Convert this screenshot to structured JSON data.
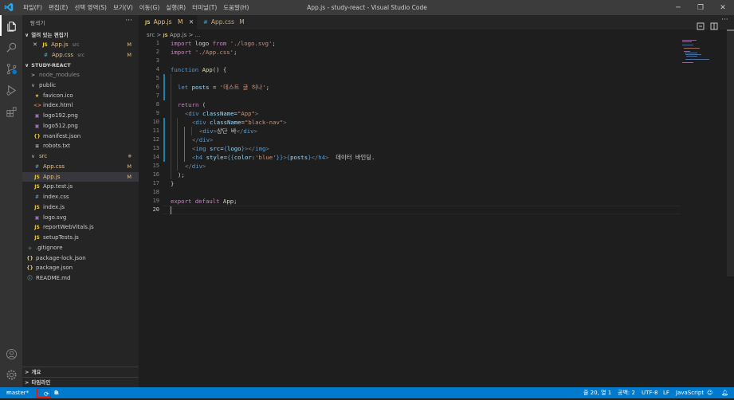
{
  "titlebar": {
    "menus": [
      "파일(F)",
      "편집(E)",
      "선택 영역(S)",
      "보기(V)",
      "이동(G)",
      "실행(R)",
      "터미널(T)",
      "도움말(H)"
    ],
    "window_title": "App.js - study-react - Visual Studio Code",
    "minimize": "─",
    "restore": "❐",
    "close": "✕"
  },
  "sidebar": {
    "header": "탐색기",
    "more": "···",
    "open_editors_title": "열려 있는 편집기",
    "open_editors": [
      {
        "close": "✕",
        "icon": "JS",
        "name": "App.js",
        "folder": "src",
        "badge": "M"
      },
      {
        "icon": "#",
        "name": "App.css",
        "folder": "src",
        "badge": "M"
      }
    ],
    "project_title": "STUDY-REACT",
    "tree": [
      {
        "arrow": ">",
        "name": "node_modules"
      },
      {
        "arrow": "∨",
        "name": "public"
      },
      {
        "icon": "★",
        "name": "favicon.ico"
      },
      {
        "icon": "<>",
        "name": "index.html"
      },
      {
        "icon": "▣",
        "name": "logo192.png"
      },
      {
        "icon": "▣",
        "name": "logo512.png"
      },
      {
        "icon": "{}",
        "name": "manifest.json"
      },
      {
        "icon": "≡",
        "name": "robots.txt"
      },
      {
        "arrow": "∨",
        "name": "src",
        "dot": "●"
      },
      {
        "icon": "#",
        "name": "App.css",
        "badge": "M"
      },
      {
        "icon": "JS",
        "name": "App.js",
        "badge": "M"
      },
      {
        "icon": "JS",
        "name": "App.test.js"
      },
      {
        "icon": "#",
        "name": "index.css"
      },
      {
        "icon": "JS",
        "name": "index.js"
      },
      {
        "icon": "▣",
        "name": "logo.svg"
      },
      {
        "icon": "JS",
        "name": "reportWebVitals.js"
      },
      {
        "icon": "JS",
        "name": "setupTests.js"
      },
      {
        "icon": "◆",
        "name": ".gitignore"
      },
      {
        "icon": "{}",
        "name": "package-lock.json"
      },
      {
        "icon": "{}",
        "name": "package.json"
      },
      {
        "icon": "ⓘ",
        "name": "README.md"
      }
    ],
    "outline_title": "개요",
    "timeline_title": "타임라인"
  },
  "editor": {
    "tabs": [
      {
        "icon": "JS",
        "name": "App.js",
        "badge": "M",
        "close": "✕"
      },
      {
        "icon": "#",
        "name": "App.css",
        "badge": "M"
      }
    ],
    "breadcrumb": [
      "src",
      ">",
      "JS",
      "App.js",
      ">",
      "..."
    ],
    "line_numbers": [
      "1",
      "2",
      "3",
      "4",
      "5",
      "6",
      "7",
      "8",
      "9",
      "10",
      "11",
      "12",
      "13",
      "14",
      "15",
      "16",
      "17",
      "18",
      "19",
      "20"
    ],
    "code": {
      "l1": [
        "import",
        " logo ",
        "from",
        " './logo.svg'",
        ";"
      ],
      "l2": [
        "import",
        " './App.css'",
        ";"
      ],
      "l4": [
        "function",
        " ",
        "App",
        "() {"
      ],
      "l6": [
        "let",
        " ",
        "posts",
        " = ",
        "'데스트 글 허나'",
        ";"
      ],
      "l8": [
        "return",
        " ("
      ],
      "l9": [
        "<",
        "div",
        " ",
        "className",
        "=",
        "\"App\"",
        ">"
      ],
      "l10": [
        "<",
        "div",
        " ",
        "className",
        "=",
        "\"black-nav\"",
        ">"
      ],
      "l11": [
        "<",
        "div",
        ">",
        "상단 바",
        "</",
        "div",
        ">"
      ],
      "l12": [
        "</",
        "div",
        ">"
      ],
      "l13": [
        "<",
        "img",
        " ",
        "src",
        "=",
        "{",
        "logo",
        "}",
        "></",
        "img",
        ">"
      ],
      "l14": [
        "<",
        "h4",
        " ",
        "style",
        "=",
        "{{",
        "color",
        ":",
        "'blue'",
        "}}",
        ">",
        "{",
        "posts",
        "}",
        "</",
        "h4",
        ">",
        "  데이터 바인딩."
      ],
      "l15": [
        "</",
        "div",
        ">"
      ],
      "l16": [
        ");"
      ],
      "l17": [
        "}"
      ],
      "l19": [
        "export",
        " ",
        "default",
        " App",
        ";"
      ]
    }
  },
  "statusbar": {
    "branch": "master*",
    "sync_icon": "⟳",
    "errors": "0",
    "warnings": "0",
    "position": "줄 20, 열 1",
    "spaces": "공백: 2",
    "encoding": "UTF-8",
    "eol": "LF",
    "language": "JavaScript"
  },
  "colors": {
    "statusbar": "#007acc",
    "activitybar": "#333333",
    "sidebar": "#252526",
    "editor": "#1e1e1e",
    "highlight_box": "#e51400"
  }
}
